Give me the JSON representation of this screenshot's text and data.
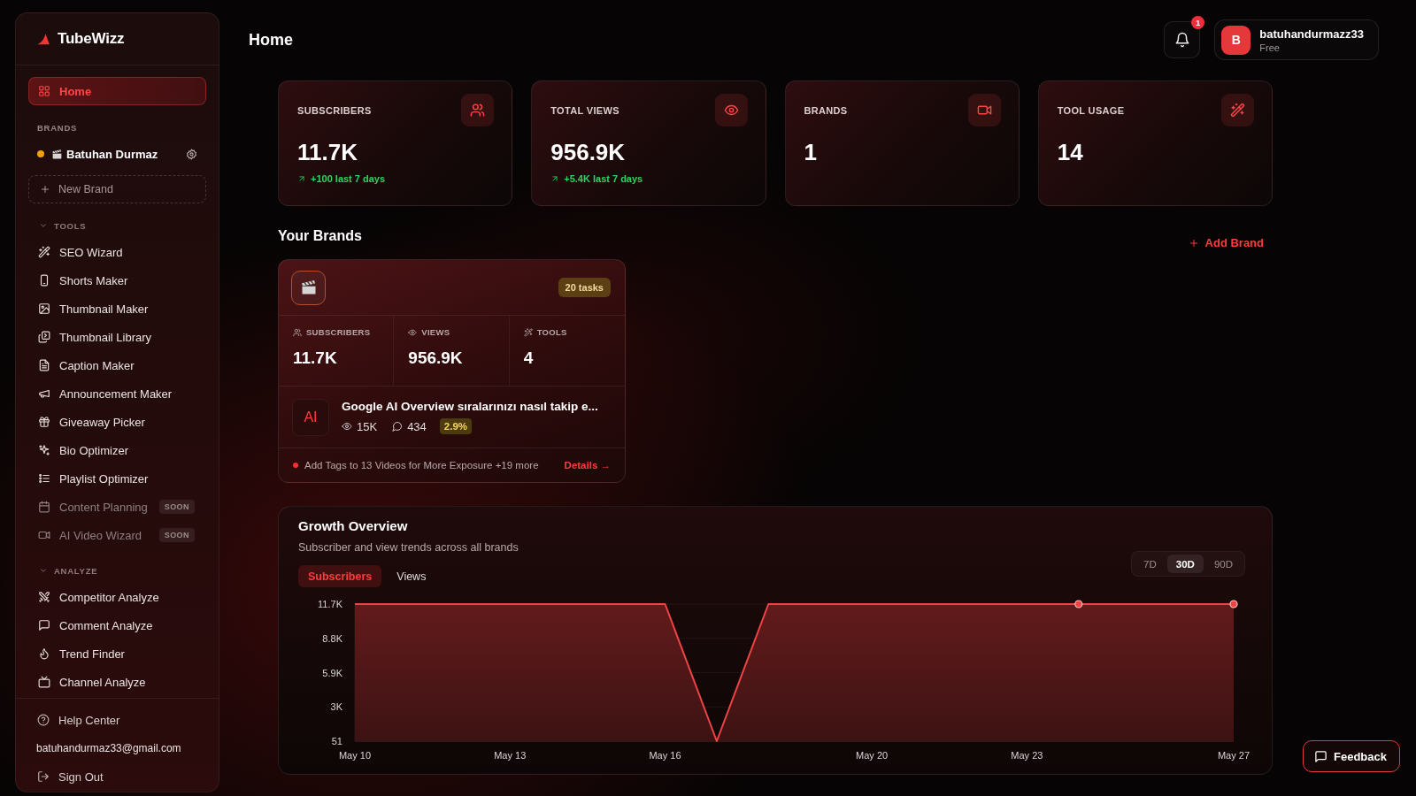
{
  "sidebar": {
    "logo": "TubeWizz",
    "home": {
      "label": "Home",
      "selected": true
    },
    "brands_label": "BRANDS",
    "brands": [
      {
        "name": "Batuhan Durmaz",
        "color": "#f59e0b"
      }
    ],
    "new_brand": "New Brand",
    "sections": [
      {
        "title": "TOOLS",
        "expanded": true,
        "items": [
          {
            "label": "SEO Wizard",
            "selected": false,
            "disabled": false
          },
          {
            "label": "Shorts Maker",
            "selected": false,
            "disabled": false
          },
          {
            "label": "Thumbnail Maker",
            "selected": false,
            "disabled": false
          },
          {
            "label": "Thumbnail Library",
            "selected": false,
            "disabled": false
          },
          {
            "label": "Caption Maker",
            "selected": false,
            "disabled": false
          },
          {
            "label": "Announcement Maker",
            "selected": false,
            "disabled": false
          },
          {
            "label": "Giveaway Picker",
            "selected": false,
            "disabled": false
          },
          {
            "label": "Bio Optimizer",
            "selected": false,
            "disabled": false
          },
          {
            "label": "Playlist Optimizer",
            "selected": false,
            "disabled": false
          },
          {
            "label": "Content Planning",
            "selected": false,
            "disabled": true,
            "badge": "SOON"
          },
          {
            "label": "AI Video Wizard",
            "selected": false,
            "disabled": true,
            "badge": "SOON"
          }
        ]
      },
      {
        "title": "ANALYZE",
        "expanded": true,
        "items": [
          {
            "label": "Competitor Analyze",
            "selected": false,
            "disabled": false
          },
          {
            "label": "Comment Analyze",
            "selected": false,
            "disabled": false
          },
          {
            "label": "Trend Finder",
            "selected": false,
            "disabled": false
          },
          {
            "label": "Channel Analyze",
            "selected": false,
            "disabled": false
          }
        ]
      }
    ],
    "footer": {
      "help": "Help Center",
      "email": "batuhandurmaz33@gmail.com",
      "sign_out": "Sign Out"
    }
  },
  "header": {
    "title": "Home",
    "notifications": {
      "count": "1"
    },
    "user": {
      "initial": "B",
      "name": "batuhandurmazz33",
      "plan": "Free"
    }
  },
  "stats": [
    {
      "label": "SUBSCRIBERS",
      "value": "11.7K",
      "delta": "+100 last 7 days"
    },
    {
      "label": "TOTAL VIEWS",
      "value": "956.9K",
      "delta": "+5.4K last 7 days"
    },
    {
      "label": "BRANDS",
      "value": "1"
    },
    {
      "label": "TOOL USAGE",
      "value": "14"
    }
  ],
  "brands_section": {
    "title": "Your Brands",
    "add_label": "Add Brand",
    "cards": [
      {
        "tasks": "20 tasks",
        "stats": [
          {
            "label": "SUBSCRIBERS",
            "value": "11.7K"
          },
          {
            "label": "VIEWS",
            "value": "956.9K"
          },
          {
            "label": "TOOLS",
            "value": "4"
          }
        ],
        "video": {
          "thumbnail_text": "AI",
          "title": "Google AI Overview sıralarınızı nasıl takip e...",
          "views": "15K",
          "comments": "434",
          "engagement": "2.9%"
        },
        "tip": "Add Tags to 13 Videos for More Exposure +19 more",
        "details": "Details →"
      }
    ]
  },
  "growth": {
    "title": "Growth Overview",
    "subtitle": "Subscriber and view trends across all brands",
    "tabs": [
      {
        "label": "Subscribers",
        "selected": true
      },
      {
        "label": "Views",
        "selected": false
      }
    ],
    "ranges": [
      {
        "label": "7D",
        "selected": false
      },
      {
        "label": "30D",
        "selected": true
      },
      {
        "label": "90D",
        "selected": false
      }
    ],
    "chart_data": [
      {
        "type": "area",
        "xlim": [
          "--05-10",
          "--05-27"
        ],
        "ylim": [
          51,
          11700
        ],
        "grid": true,
        "xticks": [
          {
            "value": "--05-10",
            "label": "May 10"
          },
          {
            "value": "--05-13",
            "label": "May 13"
          },
          {
            "value": "--05-16",
            "label": "May 16"
          },
          {
            "value": "--05-20",
            "label": "May 20"
          },
          {
            "value": "--05-23",
            "label": "May 23"
          },
          {
            "value": "--05-27",
            "label": "May 27"
          }
        ],
        "yticks": [
          {
            "value": 51,
            "label": "51"
          },
          {
            "value": 2963,
            "label": "3K"
          },
          {
            "value": 5875,
            "label": "5.9K"
          },
          {
            "value": 8788,
            "label": "8.8K"
          },
          {
            "value": 11700,
            "label": "11.7K"
          }
        ],
        "series": [
          {
            "type": "area",
            "color": "#ef4444",
            "x": [
              "--05-10",
              "--05-16",
              "--05-17",
              "--05-18",
              "--05-27"
            ],
            "values": [
              11700,
              11700,
              51,
              11700,
              11700
            ]
          },
          {
            "type": "scatter",
            "color": "#ef4444",
            "x": [
              "--05-24",
              "--05-27"
            ],
            "values": [
              11700,
              11700
            ]
          }
        ]
      }
    ]
  },
  "feedback": "Feedback"
}
